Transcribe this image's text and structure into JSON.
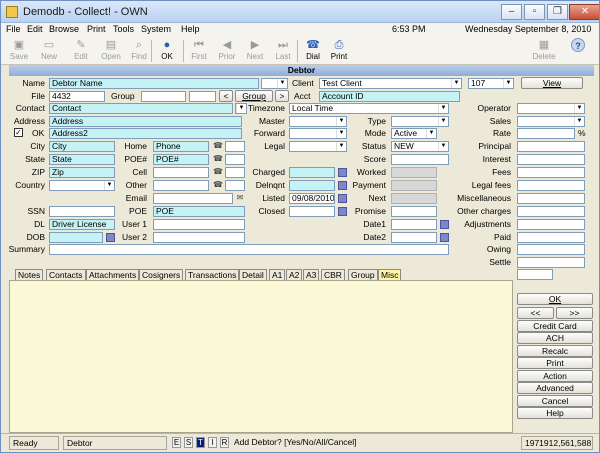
{
  "window": {
    "title": "Demodb - Collect! - OWN"
  },
  "menu": {
    "items": [
      "File",
      "Edit",
      "Browse",
      "Print",
      "Tools",
      "System",
      "Help"
    ],
    "time": "6:53 PM",
    "date": "Wednesday  September 8, 2010"
  },
  "toolbar": {
    "save": "Save",
    "new": "New",
    "edit": "Edit",
    "open": "Open",
    "find": "Find",
    "ok": "OK",
    "first": "First",
    "prior": "Prior",
    "next": "Next",
    "last": "Last",
    "dial": "Dial",
    "print": "Print",
    "delete": "Delete"
  },
  "section": {
    "title": "Debtor"
  },
  "labels": {
    "name": "Name",
    "file": "File",
    "group": "Group",
    "contact": "Contact",
    "address": "Address",
    "ok": "OK",
    "city": "City",
    "state": "State",
    "zip": "ZIP",
    "country": "Country",
    "ssn": "SSN",
    "dl": "DL",
    "dob": "DOB",
    "summary": "Summary",
    "home": "Home",
    "poe_num": "POE#",
    "cell": "Cell",
    "other": "Other",
    "email": "Email",
    "poe": "POE",
    "user1": "User 1",
    "user2": "User 2",
    "client": "Client",
    "acct": "Acct",
    "timezone": "Timezone",
    "master": "Master",
    "forward": "Forward",
    "legal": "Legal",
    "charged": "Charged",
    "delnqnt": "Delnqnt",
    "listed": "Listed",
    "closed": "Closed",
    "type": "Type",
    "mode": "Mode",
    "status": "Status",
    "score": "Score",
    "worked": "Worked",
    "payment": "Payment",
    "next": "Next",
    "promise": "Promise",
    "date1": "Date1",
    "date2": "Date2",
    "operator": "Operator",
    "sales": "Sales",
    "rate": "Rate",
    "principal": "Principal",
    "interest": "Interest",
    "fees": "Fees",
    "legal_fees": "Legal fees",
    "misc": "Miscellaneous",
    "other_charges": "Other charges",
    "adjustments": "Adjustments",
    "paid": "Paid",
    "owing": "Owing",
    "settle": "Settle"
  },
  "values": {
    "name": "Debtor Name",
    "file": "4432",
    "contact": "Contact",
    "address": "Address",
    "address2": "Address2",
    "city": "City",
    "state": "State",
    "zip": "Zip",
    "dl": "Driver License",
    "home": "Phone",
    "poe_num": "POE#",
    "poe": "POE",
    "client": "Test Client",
    "client_num": "107",
    "acct": "Account ID",
    "timezone": "Local Time",
    "listed": "09/08/2010",
    "mode": "Active",
    "status": "NEW",
    "rate_unit": "%"
  },
  "buttons": {
    "prev_group": "<",
    "group": "Group",
    "next_group": ">",
    "view": "View",
    "ok": "OK",
    "prev": "<<",
    "next": ">>",
    "credit_card": "Credit Card",
    "ach": "ACH",
    "recalc": "Recalc",
    "print": "Print",
    "action": "Action",
    "advanced": "Advanced",
    "cancel": "Cancel",
    "help": "Help"
  },
  "tabs": [
    "Notes",
    "Contacts",
    "Attachments",
    "Cosigners",
    "Transactions",
    "Detail",
    "A1",
    "A2",
    "A3",
    "CBR",
    "Group",
    "Misc"
  ],
  "statusbar": {
    "ready": "Ready",
    "context": "Debtor",
    "flags": [
      "E",
      "S",
      "T",
      "I",
      "R"
    ],
    "prompt": "Add Debtor? [Yes/No/All/Cancel]",
    "numbers": "1971912,561,588"
  }
}
